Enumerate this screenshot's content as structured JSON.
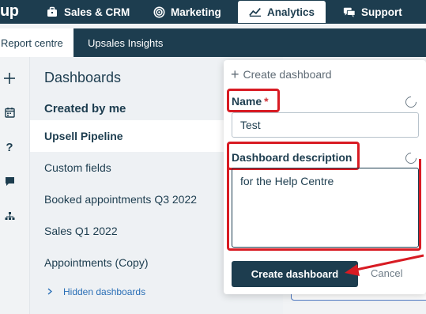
{
  "topnav": {
    "logo": "up",
    "items": [
      {
        "label": "Sales & CRM",
        "icon": "briefcase-icon"
      },
      {
        "label": "Marketing",
        "icon": "target-icon"
      },
      {
        "label": "Analytics",
        "icon": "chart-line-icon",
        "active": true
      },
      {
        "label": "Support",
        "icon": "chat-icon"
      }
    ]
  },
  "subnav": {
    "tabs": [
      {
        "label": "Report centre",
        "active": true
      },
      {
        "label": "Upsales Insights"
      }
    ]
  },
  "rail": [
    "plus-icon",
    "calendar-icon",
    "help-icon",
    "comment-icon",
    "org-chart-icon"
  ],
  "sidebar": {
    "title": "Dashboards",
    "section_title": "Created by me",
    "items": [
      {
        "label": "Upsell Pipeline",
        "selected": true
      },
      {
        "label": "Custom fields"
      },
      {
        "label": "Booked appointments Q3 2022"
      },
      {
        "label": "Sales Q1 2022"
      },
      {
        "label": "Appointments (Copy)"
      }
    ],
    "hidden_link": "Hidden dashboards"
  },
  "popover": {
    "create_link": "Create dashboard",
    "name_label": "Name",
    "required_mark": "*",
    "name_value": "Test",
    "description_label": "Dashboard description",
    "description_value": "for the Help Centre",
    "primary_button": "Create dashboard",
    "cancel_button": "Cancel"
  },
  "colors": {
    "brand": "#1d3d4f",
    "highlight": "#d81b23",
    "link": "#2a6fb6"
  }
}
